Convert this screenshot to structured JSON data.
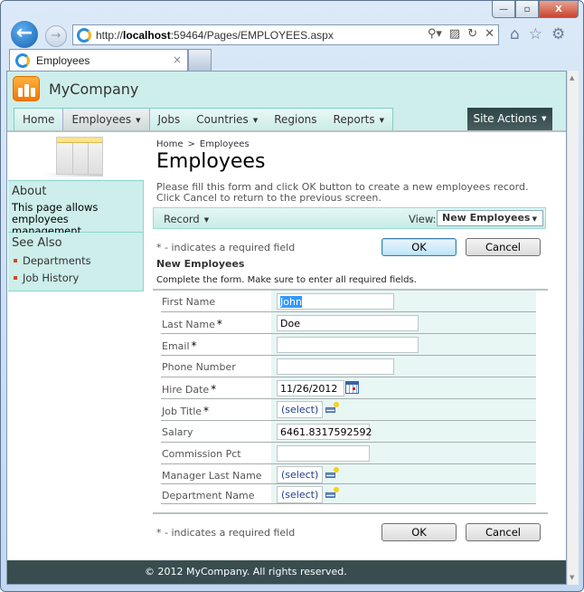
{
  "browser": {
    "window_buttons": {
      "minimize": "—",
      "maximize": "▫",
      "close": "X"
    },
    "url_prefix": "http://",
    "url_host": "localhost",
    "url_rest": ":59464/Pages/EMPLOYEES.aspx",
    "tab_title": "Employees",
    "tab_close": "×"
  },
  "site": {
    "name": "MyCompany",
    "menu": [
      {
        "label": "Home",
        "has_dropdown": false
      },
      {
        "label": "Employees",
        "has_dropdown": true,
        "active": true
      },
      {
        "label": "Jobs",
        "has_dropdown": false
      },
      {
        "label": "Countries",
        "has_dropdown": true
      },
      {
        "label": "Regions",
        "has_dropdown": false
      },
      {
        "label": "Reports",
        "has_dropdown": true
      }
    ],
    "site_actions": "Site Actions"
  },
  "sidebar": {
    "about_title": "About",
    "about_text_1": "This page allows",
    "about_text_2": "employees management.",
    "see_also_title": "See Also",
    "links": [
      "Departments",
      "Job History"
    ]
  },
  "main": {
    "breadcrumb": {
      "home": "Home",
      "separator": ">",
      "current": "Employees"
    },
    "title": "Employees",
    "description_1": "Please fill this form and click OK button to create a new employees record.",
    "description_2": "Click Cancel to return to the previous screen.",
    "action_bar": {
      "record": "Record",
      "view_label": "View:",
      "view_value": "New Employees"
    },
    "required_note": "* - indicates a required field",
    "ok": "OK",
    "cancel": "Cancel",
    "form_title": "New Employees",
    "form_desc": "Complete the form. Make sure to enter all required fields.",
    "fields": [
      {
        "label": "First Name",
        "required": false,
        "type": "text",
        "value": "John",
        "selected": true
      },
      {
        "label": "Last Name",
        "required": true,
        "type": "text",
        "value": "Doe"
      },
      {
        "label": "Email",
        "required": true,
        "type": "text",
        "value": ""
      },
      {
        "label": "Phone Number",
        "required": false,
        "type": "text",
        "value": ""
      },
      {
        "label": "Hire Date",
        "required": true,
        "type": "date",
        "value": "11/26/2012"
      },
      {
        "label": "Job Title",
        "required": true,
        "type": "lookup",
        "value": "(select)"
      },
      {
        "label": "Salary",
        "required": false,
        "type": "text",
        "value": "6461.8317592592"
      },
      {
        "label": "Commission Pct",
        "required": false,
        "type": "text",
        "value": ""
      },
      {
        "label": "Manager Last Name",
        "required": false,
        "type": "lookup",
        "value": "(select)"
      },
      {
        "label": "Department Name",
        "required": false,
        "type": "lookup",
        "value": "(select)"
      }
    ],
    "required_marker": "*"
  },
  "footer": {
    "text": "© 2012 MyCompany. All rights reserved."
  }
}
